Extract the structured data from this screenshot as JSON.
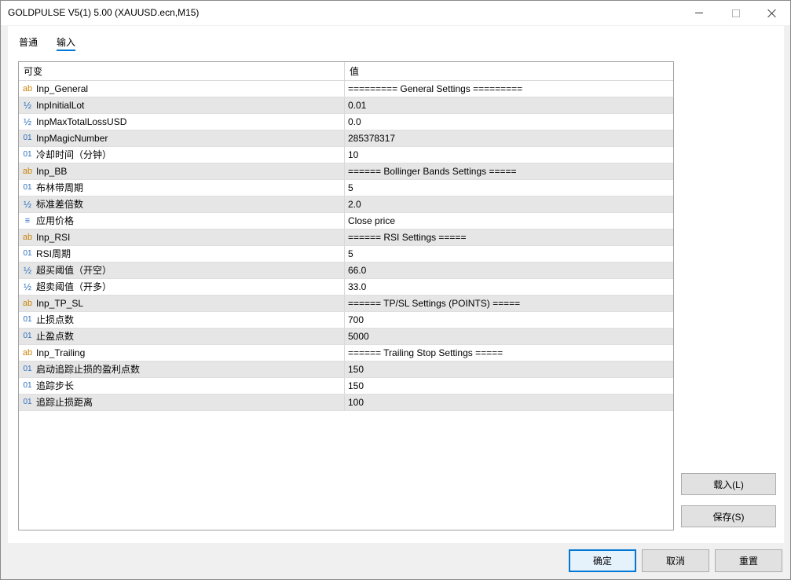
{
  "window": {
    "title": "GOLDPULSE V5(1) 5.00 (XAUUSD.ecn,M15)"
  },
  "tabs": [
    {
      "label": "普通",
      "active": false
    },
    {
      "label": "输入",
      "active": true
    }
  ],
  "grid": {
    "headers": {
      "variable": "可变",
      "value": "值"
    },
    "rows": [
      {
        "icon": "ab",
        "icon_name": "string-type-icon",
        "name": "Inp_General",
        "value": "========= General Settings ========="
      },
      {
        "icon": "½",
        "icon_name": "double-type-icon",
        "name": "InpInitialLot",
        "value": "0.01"
      },
      {
        "icon": "½",
        "icon_name": "double-type-icon",
        "name": "InpMaxTotalLossUSD",
        "value": "0.0"
      },
      {
        "icon": "01",
        "icon_name": "integer-type-icon",
        "name": "InpMagicNumber",
        "value": "285378317"
      },
      {
        "icon": "01",
        "icon_name": "integer-type-icon",
        "name": "冷却时间（分钟）",
        "value": "10"
      },
      {
        "icon": "ab",
        "icon_name": "string-type-icon",
        "name": "Inp_BB",
        "value": "====== Bollinger Bands Settings ====="
      },
      {
        "icon": "01",
        "icon_name": "integer-type-icon",
        "name": "布林带周期",
        "value": "5"
      },
      {
        "icon": "½",
        "icon_name": "double-type-icon",
        "name": "标准差倍数",
        "value": "2.0"
      },
      {
        "icon": "≡",
        "icon_name": "enum-type-icon",
        "name": "应用价格",
        "value": "Close price"
      },
      {
        "icon": "ab",
        "icon_name": "string-type-icon",
        "name": "Inp_RSI",
        "value": "====== RSI Settings ====="
      },
      {
        "icon": "01",
        "icon_name": "integer-type-icon",
        "name": "RSI周期",
        "value": "5"
      },
      {
        "icon": "½",
        "icon_name": "double-type-icon",
        "name": "超买阈值（开空）",
        "value": "66.0"
      },
      {
        "icon": "½",
        "icon_name": "double-type-icon",
        "name": "超卖阈值（开多）",
        "value": "33.0"
      },
      {
        "icon": "ab",
        "icon_name": "string-type-icon",
        "name": "Inp_TP_SL",
        "value": "====== TP/SL Settings (POINTS) ====="
      },
      {
        "icon": "01",
        "icon_name": "integer-type-icon",
        "name": "止损点数",
        "value": "700"
      },
      {
        "icon": "01",
        "icon_name": "integer-type-icon",
        "name": "止盈点数",
        "value": "5000"
      },
      {
        "icon": "ab",
        "icon_name": "string-type-icon",
        "name": "Inp_Trailing",
        "value": "====== Trailing Stop Settings ====="
      },
      {
        "icon": "01",
        "icon_name": "integer-type-icon",
        "name": "启动追踪止损的盈利点数",
        "value": "150"
      },
      {
        "icon": "01",
        "icon_name": "integer-type-icon",
        "name": "追踪步长",
        "value": "150"
      },
      {
        "icon": "01",
        "icon_name": "integer-type-icon",
        "name": "追踪止损距离",
        "value": "100"
      }
    ]
  },
  "side_buttons": {
    "load": "载入(L)",
    "save": "保存(S)"
  },
  "bottom_buttons": {
    "ok": "确定",
    "cancel": "取消",
    "reset": "重置"
  },
  "colors": {
    "accent": "#0078d7",
    "alt_row": "#e6e6e6",
    "string_icon": "#c9860b",
    "numeric_icon": "#2a6ebd"
  }
}
